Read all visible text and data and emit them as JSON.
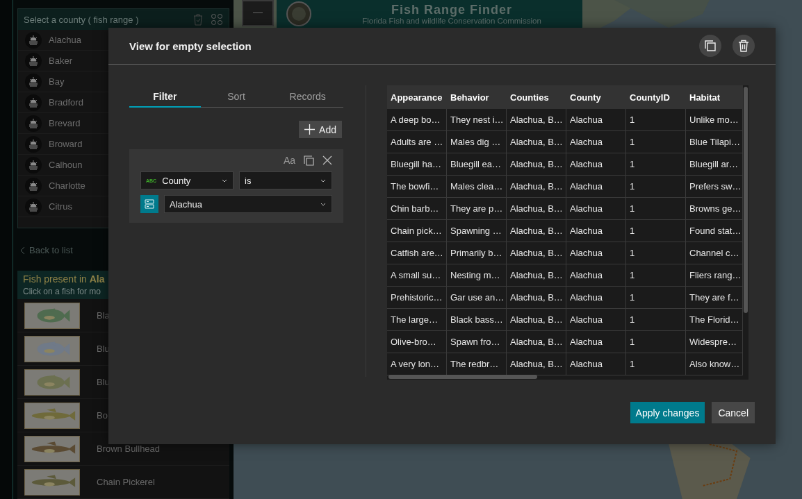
{
  "sidebar": {
    "county_list": {
      "title": "Select a county ( fish range )",
      "items": [
        "Alachua",
        "Baker",
        "Bay",
        "Bradford",
        "Brevard",
        "Broward",
        "Calhoun",
        "Charlotte",
        "Citrus"
      ]
    },
    "back_link": "Back to list",
    "fish_panel": {
      "title": "Fish present in **Ala**",
      "subtitle": "Click on a fish for mo",
      "fish": [
        {
          "name": "Bla",
          "kind": "picture"
        },
        {
          "name": "Blu",
          "kind": "picture"
        },
        {
          "name": "Blu",
          "kind": "picture"
        },
        {
          "name": "Bo",
          "kind": "picture"
        },
        {
          "name": "Brown Bullhead",
          "kind": "picture"
        },
        {
          "name": "Chain Pickerel",
          "kind": "picture"
        }
      ]
    }
  },
  "header": {
    "title": "Fish Range Finder",
    "subtitle": "Florida Fish and wildlife Conservation Commission"
  },
  "dialog": {
    "title": "View for empty selection",
    "tabs": [
      {
        "label": "Filter",
        "selected": true
      },
      {
        "label": "Sort",
        "selected": false
      },
      {
        "label": "Records",
        "selected": false
      }
    ],
    "add_button": "Add",
    "filter": {
      "case_toggle": "Aa",
      "field_type": "ABC",
      "field": "County",
      "operator": "is",
      "value": "Alachua"
    },
    "table": {
      "columns": [
        "Appearance",
        "Behavior",
        "Counties",
        "County",
        "CountyID",
        "Habitat"
      ],
      "rows": [
        [
          "A deep bo…",
          "They nest i…",
          "Alachua, B…",
          "Alachua",
          "1",
          "Unlike mo…"
        ],
        [
          "Adults are …",
          "Males dig …",
          "Alachua, B…",
          "Alachua",
          "1",
          "Blue Tilapi…"
        ],
        [
          "Bluegill ha…",
          "Bluegill ea…",
          "Alachua, B…",
          "Alachua",
          "1",
          "Bluegill ar…"
        ],
        [
          "The bowfi…",
          "Males clea…",
          "Alachua, B…",
          "Alachua",
          "1",
          "Prefers sw…"
        ],
        [
          "Chin barb…",
          "They are p…",
          "Alachua, B…",
          "Alachua",
          "1",
          "Browns ge…"
        ],
        [
          "Chain pick…",
          "Spawning …",
          "Alachua, B…",
          "Alachua",
          "1",
          "Found stat…"
        ],
        [
          "Catfish are…",
          "Primarily b…",
          "Alachua, B…",
          "Alachua",
          "1",
          "Channel c…"
        ],
        [
          "A small su…",
          "Nesting m…",
          "Alachua, B…",
          "Alachua",
          "1",
          "Fliers rang…"
        ],
        [
          "Prehistoric…",
          "Gar use an…",
          "Alachua, B…",
          "Alachua",
          "1",
          "They are f…"
        ],
        [
          "The large…",
          "Black bass…",
          "Alachua, B…",
          "Alachua",
          "1",
          "The Florid…"
        ],
        [
          "Olive-bro…",
          "Spawn fro…",
          "Alachua, B…",
          "Alachua",
          "1",
          "Widespre…"
        ],
        [
          "A very lon…",
          "The redbr…",
          "Alachua, B…",
          "Alachua",
          "1",
          "Also know…"
        ]
      ]
    },
    "buttons": {
      "apply": "Apply changes",
      "cancel": "Cancel"
    }
  }
}
